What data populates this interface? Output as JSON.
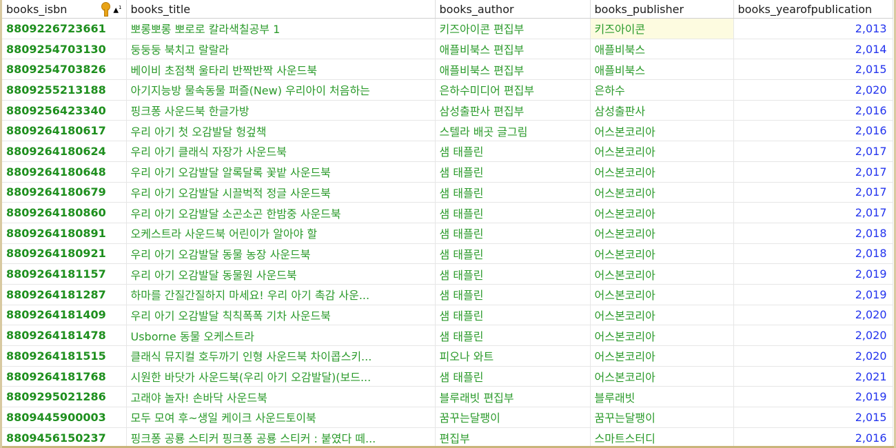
{
  "columns": [
    "books_isbn",
    "books_title",
    "books_author",
    "books_publisher",
    "books_yearofpublication"
  ],
  "colors": {
    "isbn": "#1e8f1e",
    "text": "#2a9a2a",
    "year": "#2233ee",
    "selected_cell": "#fdfbe0"
  },
  "icons": {
    "primary_key": "key-icon",
    "sort": "sort-ascending-icon"
  },
  "rows": [
    {
      "isbn": "8809226723661",
      "title": "뽀롱뽀롱 뽀로로 칼라색칠공부 1",
      "author": "키즈아이콘 편집부",
      "publisher": "키즈아이콘",
      "year": "2,013"
    },
    {
      "isbn": "8809254703130",
      "title": "둥둥둥 북치고 랄랄라",
      "author": "애플비북스 편집부",
      "publisher": "애플비북스",
      "year": "2,014"
    },
    {
      "isbn": "8809254703826",
      "title": "베이비 초점책 울타리 반짝반짝 사운드북",
      "author": "애플비북스 편집부",
      "publisher": "애플비북스",
      "year": "2,015"
    },
    {
      "isbn": "8809255213188",
      "title": "아기지능방 물속동물 퍼즐(New) 우리아이 처음하는",
      "author": "은하수미디어 편집부",
      "publisher": "은하수",
      "year": "2,020"
    },
    {
      "isbn": "8809256423340",
      "title": "핑크퐁 사운드북 한글가방",
      "author": "삼성출판사 편집부",
      "publisher": "삼성출판사",
      "year": "2,016"
    },
    {
      "isbn": "8809264180617",
      "title": "우리 아기 첫 오감발달 헝겊책",
      "author": "스텔라 배곳 글그림",
      "publisher": "어스본코리아",
      "year": "2,016"
    },
    {
      "isbn": "8809264180624",
      "title": "우리 아기 클래식 자장가 사운드북",
      "author": "샘 태플린",
      "publisher": "어스본코리아",
      "year": "2,017"
    },
    {
      "isbn": "8809264180648",
      "title": "우리 아기 오감발달 알록달록 꽃밭 사운드북",
      "author": "샘 태플린",
      "publisher": "어스본코리아",
      "year": "2,017"
    },
    {
      "isbn": "8809264180679",
      "title": "우리 아기 오감발달 시끌벅적 정글 사운드북",
      "author": "샘 태플린",
      "publisher": "어스본코리아",
      "year": "2,017"
    },
    {
      "isbn": "8809264180860",
      "title": "우리 아기 오감발달 소곤소곤 한밤중 사운드북",
      "author": "샘 태플린",
      "publisher": "어스본코리아",
      "year": "2,017"
    },
    {
      "isbn": "8809264180891",
      "title": "오케스트라 사운드북 어린이가 알아야 할",
      "author": "샘 태플린",
      "publisher": "어스본코리아",
      "year": "2,018"
    },
    {
      "isbn": "8809264180921",
      "title": "우리 아기 오감발달 동물 농장 사운드북",
      "author": "샘 태플린",
      "publisher": "어스본코리아",
      "year": "2,018"
    },
    {
      "isbn": "8809264181157",
      "title": "우리 아기 오감발달 동물원 사운드북",
      "author": "샘 태플린",
      "publisher": "어스본코리아",
      "year": "2,019"
    },
    {
      "isbn": "8809264181287",
      "title": "하마를 간질간질하지 마세요! 우리 아기 촉감 사운...",
      "author": "샘 태플린",
      "publisher": "어스본코리아",
      "year": "2,019"
    },
    {
      "isbn": "8809264181409",
      "title": "우리 아기 오감발달 칙칙폭폭 기차 사운드북",
      "author": "샘 태플린",
      "publisher": "어스본코리아",
      "year": "2,020"
    },
    {
      "isbn": "8809264181478",
      "title": "Usborne 동물 오케스트라",
      "author": "샘 태플린",
      "publisher": "어스본코리아",
      "year": "2,020"
    },
    {
      "isbn": "8809264181515",
      "title": "클래식 뮤지컬 호두까기 인형 사운드북 차이콥스키...",
      "author": "피오나 와트",
      "publisher": "어스본코리아",
      "year": "2,020"
    },
    {
      "isbn": "8809264181768",
      "title": "시원한 바닷가 사운드북(우리 아기 오감발달)(보드...",
      "author": "샘 태플린",
      "publisher": "어스본코리아",
      "year": "2,021"
    },
    {
      "isbn": "8809295021286",
      "title": "고래야 놀자! 손바닥 사운드북",
      "author": "블루래빗 편집부",
      "publisher": "블루래빗",
      "year": "2,019"
    },
    {
      "isbn": "8809445900003",
      "title": "모두 모여 후~생일 케이크 사운드토이북",
      "author": "꿈꾸는달팽이",
      "publisher": "꿈꾸는달팽이",
      "year": "2,015"
    },
    {
      "isbn": "8809456150237",
      "title": "핑크퐁 공룡 스티커 핑크퐁 공룡 스티커 : 붙였다 떼...",
      "author": "편집부",
      "publisher": "스마트스터디",
      "year": "2,016"
    }
  ],
  "selected": {
    "row": 0,
    "column": "publisher"
  }
}
